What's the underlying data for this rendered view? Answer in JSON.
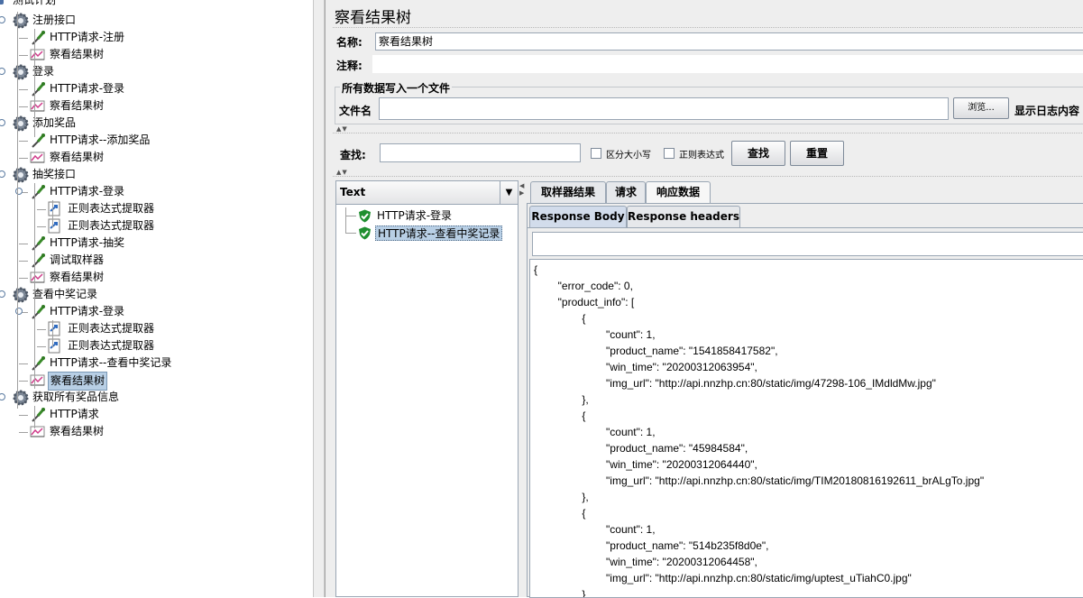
{
  "tree": {
    "root_label": "测试计划",
    "items": [
      {
        "label": "注册接口",
        "icon": "gear-icon"
      },
      {
        "label": "HTTP请求-注册",
        "icon": "sampler-icon"
      },
      {
        "label": "察看结果树",
        "icon": "listener-icon"
      },
      {
        "label": "登录",
        "icon": "gear-icon"
      },
      {
        "label": "HTTP请求-登录",
        "icon": "sampler-icon"
      },
      {
        "label": "察看结果树",
        "icon": "listener-icon"
      },
      {
        "label": "添加奖品",
        "icon": "gear-icon"
      },
      {
        "label": "HTTP请求--添加奖品",
        "icon": "sampler-icon"
      },
      {
        "label": "察看结果树",
        "icon": "listener-icon"
      },
      {
        "label": "抽奖接口",
        "icon": "gear-icon"
      },
      {
        "label": "HTTP请求-登录",
        "icon": "sampler-icon"
      },
      {
        "label": "正则表达式提取器",
        "icon": "extractor-icon"
      },
      {
        "label": "正则表达式提取器",
        "icon": "extractor-icon"
      },
      {
        "label": "HTTP请求-抽奖",
        "icon": "sampler-icon"
      },
      {
        "label": "调试取样器",
        "icon": "sampler-icon"
      },
      {
        "label": "察看结果树",
        "icon": "listener-icon"
      },
      {
        "label": "查看中奖记录",
        "icon": "gear-icon"
      },
      {
        "label": "HTTP请求-登录",
        "icon": "sampler-icon"
      },
      {
        "label": "正则表达式提取器",
        "icon": "extractor-icon"
      },
      {
        "label": "正则表达式提取器",
        "icon": "extractor-icon"
      },
      {
        "label": "HTTP请求--查看中奖记录",
        "icon": "sampler-icon"
      },
      {
        "label": "察看结果树",
        "icon": "listener-icon"
      },
      {
        "label": "获取所有奖品信息",
        "icon": "gear-icon"
      },
      {
        "label": "HTTP请求",
        "icon": "sampler-icon"
      },
      {
        "label": "察看结果树",
        "icon": "listener-icon"
      }
    ]
  },
  "panel": {
    "title": "察看结果树",
    "name_label": "名称:",
    "name_value": "察看结果树",
    "comment_label": "注释:",
    "file_section_title": "所有数据写入一个文件",
    "filename_label": "文件名",
    "browse_label": "浏览...",
    "log_label": "显示日志内容",
    "search_label": "查找:",
    "case_label": "区分大小写",
    "regex_label": "正则表达式",
    "find_label": "查找",
    "reset_label": "重置",
    "renderer_value": "Text"
  },
  "results": {
    "items": [
      {
        "label": "HTTP请求-登录",
        "status": "success"
      },
      {
        "label": "HTTP请求--查看中奖记录",
        "status": "success"
      }
    ]
  },
  "tabs": {
    "main": [
      "取样器结果",
      "请求",
      "响应数据"
    ],
    "sub": [
      "Response Body",
      "Response headers"
    ]
  },
  "response_lines": [
    "{",
    "        \"error_code\": 0,",
    "        \"product_info\": [",
    "                {",
    "                        \"count\": 1,",
    "                        \"product_name\": \"1541858417582\",",
    "                        \"win_time\": \"20200312063954\",",
    "                        \"img_url\": \"http://api.nnzhp.cn:80/static/img/47298-106_IMdldMw.jpg\"",
    "                },",
    "                {",
    "                        \"count\": 1,",
    "                        \"product_name\": \"45984584\",",
    "                        \"win_time\": \"20200312064440\",",
    "                        \"img_url\": \"http://api.nnzhp.cn:80/static/img/TIM20180816192611_brALgTo.jpg\"",
    "                },",
    "                {",
    "                        \"count\": 1,",
    "                        \"product_name\": \"514b235f8d0e\",",
    "                        \"win_time\": \"20200312064458\",",
    "                        \"img_url\": \"http://api.nnzhp.cn:80/static/img/uptest_uTiahC0.jpg\"",
    "                }"
  ]
}
